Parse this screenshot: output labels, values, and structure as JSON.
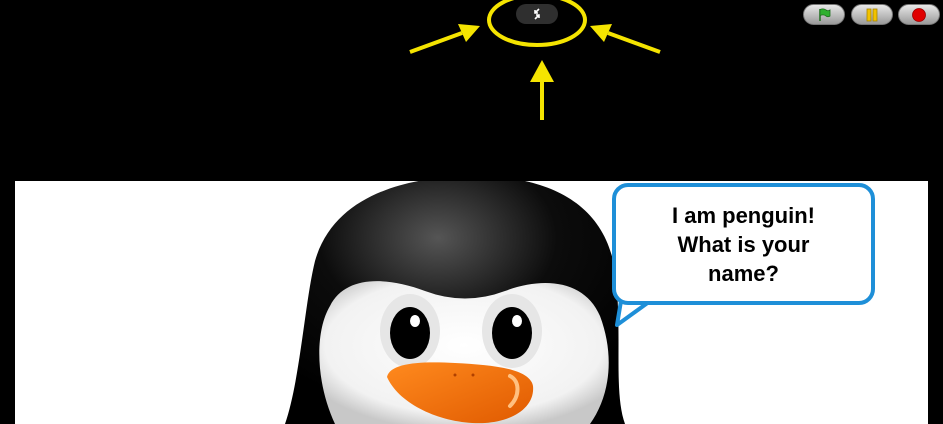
{
  "toolbar": {
    "exit_fullscreen_icon": "shrink-arrows-icon",
    "green_flag_icon": "green-flag-icon",
    "pause_icon": "pause-icon",
    "stop_icon": "stop-icon",
    "colors": {
      "flag": "#2fb02f",
      "pause": "#f2c200",
      "stop": "#e00000"
    }
  },
  "annotation": {
    "color": "#f5e400"
  },
  "stage": {
    "speech_bubble": "I am penguin! What is your name?",
    "bubble_border_color": "#1e8fd8"
  }
}
